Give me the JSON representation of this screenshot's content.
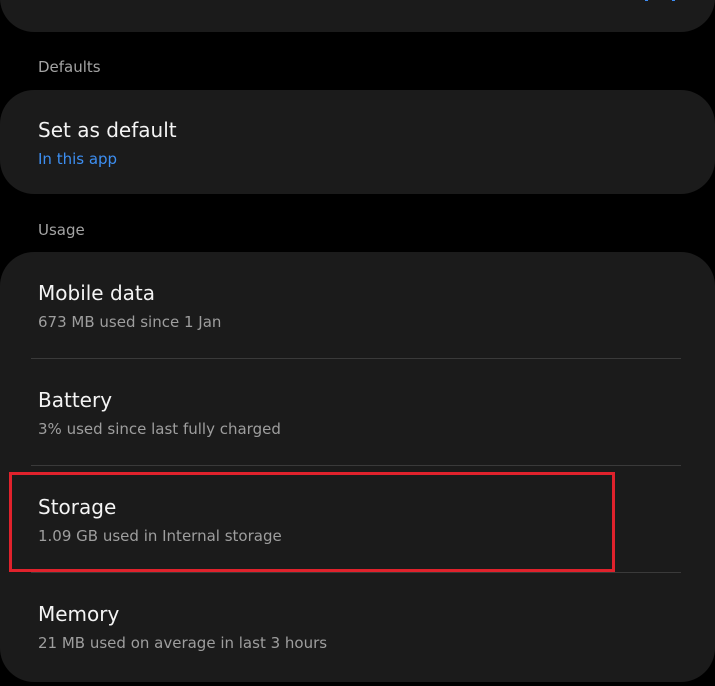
{
  "sections": {
    "defaults_label": "Defaults",
    "usage_label": "Usage"
  },
  "defaults": {
    "title": "Set as default",
    "subtitle": "In this app"
  },
  "usage": {
    "items": [
      {
        "title": "Mobile data",
        "subtitle": "673 MB used since 1 Jan"
      },
      {
        "title": "Battery",
        "subtitle": "3% used since last fully charged"
      },
      {
        "title": "Storage",
        "subtitle": "1.09 GB used in Internal storage"
      },
      {
        "title": "Memory",
        "subtitle": "21 MB used on average in last 3 hours"
      }
    ]
  },
  "colors": {
    "accent": "#3d8ff2",
    "highlight": "#e0222c",
    "card": "#1b1b1b",
    "background": "#000000"
  }
}
